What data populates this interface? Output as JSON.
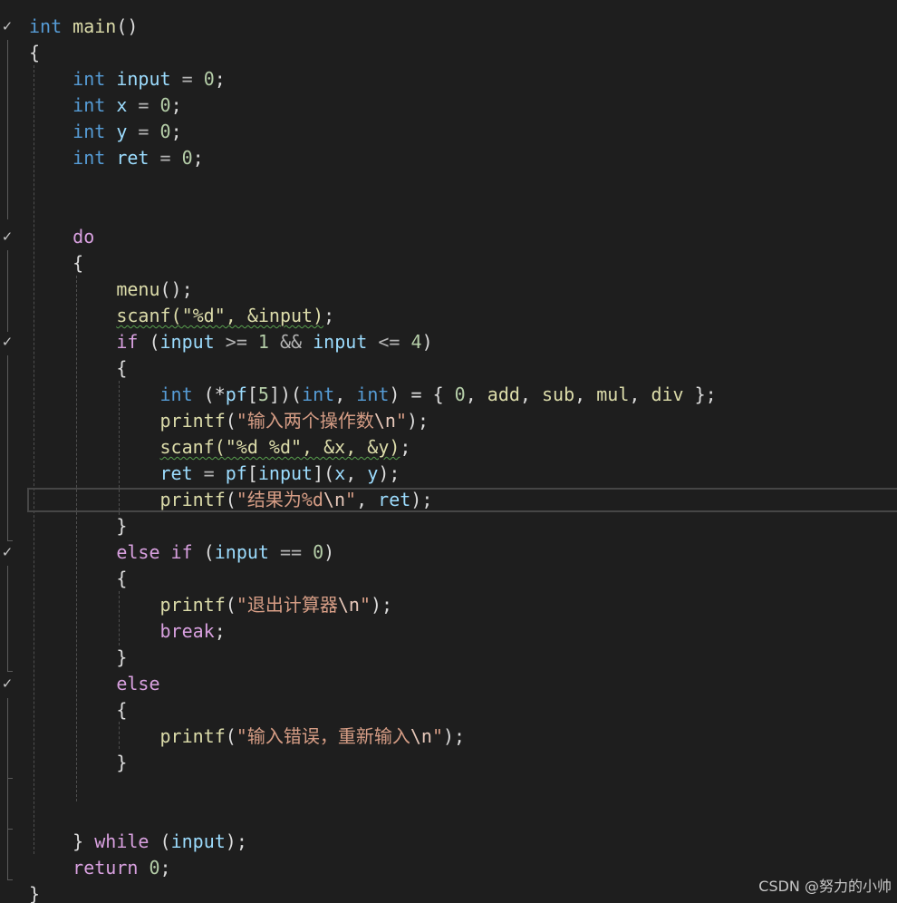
{
  "code_lines": [
    [
      {
        "t": "int",
        "c": "kw"
      },
      {
        "t": " "
      },
      {
        "t": "main",
        "c": "fn"
      },
      {
        "t": "()",
        "c": "pun"
      }
    ],
    [
      {
        "t": "{",
        "c": "pun"
      }
    ],
    [
      {
        "t": "    "
      },
      {
        "t": "int",
        "c": "kw"
      },
      {
        "t": " "
      },
      {
        "t": "input",
        "c": "var"
      },
      {
        "t": " = ",
        "c": "op"
      },
      {
        "t": "0",
        "c": "num"
      },
      {
        "t": ";",
        "c": "pun"
      }
    ],
    [
      {
        "t": "    "
      },
      {
        "t": "int",
        "c": "kw"
      },
      {
        "t": " "
      },
      {
        "t": "x",
        "c": "var"
      },
      {
        "t": " = ",
        "c": "op"
      },
      {
        "t": "0",
        "c": "num"
      },
      {
        "t": ";",
        "c": "pun"
      }
    ],
    [
      {
        "t": "    "
      },
      {
        "t": "int",
        "c": "kw"
      },
      {
        "t": " "
      },
      {
        "t": "y",
        "c": "var"
      },
      {
        "t": " = ",
        "c": "op"
      },
      {
        "t": "0",
        "c": "num"
      },
      {
        "t": ";",
        "c": "pun"
      }
    ],
    [
      {
        "t": "    "
      },
      {
        "t": "int",
        "c": "kw"
      },
      {
        "t": " "
      },
      {
        "t": "ret",
        "c": "var"
      },
      {
        "t": " = ",
        "c": "op"
      },
      {
        "t": "0",
        "c": "num"
      },
      {
        "t": ";",
        "c": "pun"
      }
    ],
    [],
    [],
    [
      {
        "t": "    "
      },
      {
        "t": "do",
        "c": "ctl"
      }
    ],
    [
      {
        "t": "    "
      },
      {
        "t": "{",
        "c": "pun"
      }
    ],
    [
      {
        "t": "        "
      },
      {
        "t": "menu",
        "c": "fn"
      },
      {
        "t": "();",
        "c": "pun"
      }
    ],
    [
      {
        "t": "        "
      },
      {
        "t": "scanf(\"%d\", &input)",
        "c": "fn squiggle"
      },
      {
        "t": ";",
        "c": "pun"
      }
    ],
    [
      {
        "t": "        "
      },
      {
        "t": "if",
        "c": "ctl"
      },
      {
        "t": " ("
      },
      {
        "t": "input",
        "c": "var"
      },
      {
        "t": " >= ",
        "c": "op"
      },
      {
        "t": "1",
        "c": "num"
      },
      {
        "t": " && ",
        "c": "op"
      },
      {
        "t": "input",
        "c": "var"
      },
      {
        "t": " <= ",
        "c": "op"
      },
      {
        "t": "4",
        "c": "num"
      },
      {
        "t": ")",
        "c": "pun"
      }
    ],
    [
      {
        "t": "        "
      },
      {
        "t": "{",
        "c": "pun"
      }
    ],
    [
      {
        "t": "            "
      },
      {
        "t": "int",
        "c": "kw"
      },
      {
        "t": " (*"
      },
      {
        "t": "pf",
        "c": "var"
      },
      {
        "t": "[",
        "c": "pun"
      },
      {
        "t": "5",
        "c": "num"
      },
      {
        "t": "])(",
        "c": "pun"
      },
      {
        "t": "int",
        "c": "kw"
      },
      {
        "t": ", "
      },
      {
        "t": "int",
        "c": "kw"
      },
      {
        "t": ") = { ",
        "c": "pun"
      },
      {
        "t": "0",
        "c": "num"
      },
      {
        "t": ", "
      },
      {
        "t": "add",
        "c": "fn"
      },
      {
        "t": ", "
      },
      {
        "t": "sub",
        "c": "fn"
      },
      {
        "t": ", "
      },
      {
        "t": "mul",
        "c": "fn"
      },
      {
        "t": ", "
      },
      {
        "t": "div",
        "c": "fn"
      },
      {
        "t": " };",
        "c": "pun"
      }
    ],
    [
      {
        "t": "            "
      },
      {
        "t": "printf",
        "c": "fn"
      },
      {
        "t": "(",
        "c": "pun"
      },
      {
        "t": "\"输入两个操作数",
        "c": "str"
      },
      {
        "t": "\\n",
        "c": "esc"
      },
      {
        "t": "\"",
        "c": "str"
      },
      {
        "t": ");",
        "c": "pun"
      }
    ],
    [
      {
        "t": "            "
      },
      {
        "t": "scanf(\"%d %d\", &x, &y)",
        "c": "fn squiggle"
      },
      {
        "t": ";",
        "c": "pun"
      }
    ],
    [
      {
        "t": "            "
      },
      {
        "t": "ret",
        "c": "var"
      },
      {
        "t": " = ",
        "c": "op"
      },
      {
        "t": "pf",
        "c": "var"
      },
      {
        "t": "[",
        "c": "pun"
      },
      {
        "t": "input",
        "c": "var"
      },
      {
        "t": "](",
        "c": "pun"
      },
      {
        "t": "x",
        "c": "var"
      },
      {
        "t": ", "
      },
      {
        "t": "y",
        "c": "var"
      },
      {
        "t": ");",
        "c": "pun"
      }
    ],
    [
      {
        "t": "            "
      },
      {
        "t": "printf",
        "c": "fn"
      },
      {
        "t": "(",
        "c": "pun"
      },
      {
        "t": "\"结果为%d",
        "c": "str"
      },
      {
        "t": "\\n",
        "c": "esc"
      },
      {
        "t": "\"",
        "c": "str"
      },
      {
        "t": ", "
      },
      {
        "t": "ret",
        "c": "var"
      },
      {
        "t": ");",
        "c": "pun"
      }
    ],
    [
      {
        "t": "        "
      },
      {
        "t": "}",
        "c": "pun"
      }
    ],
    [
      {
        "t": "        "
      },
      {
        "t": "else",
        "c": "ctl"
      },
      {
        "t": " "
      },
      {
        "t": "if",
        "c": "ctl"
      },
      {
        "t": " ("
      },
      {
        "t": "input",
        "c": "var"
      },
      {
        "t": " == ",
        "c": "op"
      },
      {
        "t": "0",
        "c": "num"
      },
      {
        "t": ")",
        "c": "pun"
      }
    ],
    [
      {
        "t": "        "
      },
      {
        "t": "{",
        "c": "pun"
      }
    ],
    [
      {
        "t": "            "
      },
      {
        "t": "printf",
        "c": "fn"
      },
      {
        "t": "(",
        "c": "pun"
      },
      {
        "t": "\"退出计算器",
        "c": "str"
      },
      {
        "t": "\\n",
        "c": "esc"
      },
      {
        "t": "\"",
        "c": "str"
      },
      {
        "t": ");",
        "c": "pun"
      }
    ],
    [
      {
        "t": "            "
      },
      {
        "t": "break",
        "c": "ctl"
      },
      {
        "t": ";",
        "c": "pun"
      }
    ],
    [
      {
        "t": "        "
      },
      {
        "t": "}",
        "c": "pun"
      }
    ],
    [
      {
        "t": "        "
      },
      {
        "t": "else",
        "c": "ctl"
      }
    ],
    [
      {
        "t": "        "
      },
      {
        "t": "{",
        "c": "pun"
      }
    ],
    [
      {
        "t": "            "
      },
      {
        "t": "printf",
        "c": "fn"
      },
      {
        "t": "(",
        "c": "pun"
      },
      {
        "t": "\"输入错误，重新输入",
        "c": "str"
      },
      {
        "t": "\\n",
        "c": "esc"
      },
      {
        "t": "\"",
        "c": "str"
      },
      {
        "t": ");",
        "c": "pun"
      }
    ],
    [
      {
        "t": "        "
      },
      {
        "t": "}",
        "c": "pun"
      }
    ],
    [],
    [],
    [
      {
        "t": "    "
      },
      {
        "t": "}",
        "c": "pun"
      },
      {
        "t": " "
      },
      {
        "t": "while",
        "c": "ctl"
      },
      {
        "t": " ("
      },
      {
        "t": "input",
        "c": "var"
      },
      {
        "t": ");",
        "c": "pun"
      }
    ],
    [
      {
        "t": "    "
      },
      {
        "t": "return",
        "c": "ctl"
      },
      {
        "t": " "
      },
      {
        "t": "0",
        "c": "num"
      },
      {
        "t": ";",
        "c": "pun"
      }
    ],
    [
      {
        "t": "}",
        "c": "pun"
      }
    ]
  ],
  "fold_markers": [
    {
      "line": 0,
      "icon": "chevron-down-icon",
      "glyph": "✓"
    },
    {
      "line": 8,
      "icon": "chevron-down-icon",
      "glyph": "✓"
    },
    {
      "line": 12,
      "icon": "chevron-down-icon",
      "glyph": "✓"
    },
    {
      "line": 20,
      "icon": "chevron-down-icon",
      "glyph": "✓"
    },
    {
      "line": 25,
      "icon": "chevron-down-icon",
      "glyph": "✓"
    }
  ],
  "current_line": 18,
  "watermark": "CSDN @努力的小帅",
  "colors": {
    "background": "#1e1e1e",
    "keyword": "#569cd6",
    "control": "#d8a0df",
    "function": "#dcdcaa",
    "variable": "#9cdcfe",
    "number": "#b5cea8",
    "string": "#d69d85",
    "squiggle": "#59a14f"
  }
}
